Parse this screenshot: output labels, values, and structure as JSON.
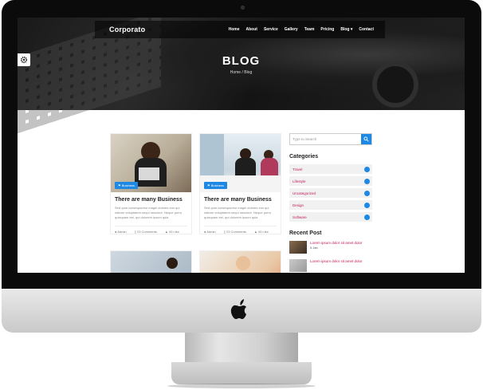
{
  "site": {
    "brand": "Corporato",
    "nav": [
      "Home",
      "About",
      "Service",
      "Gallery",
      "Team",
      "Pricing",
      "Blog",
      "Contact"
    ],
    "hero_title": "BLOG",
    "breadcrumb": "Home / Blog"
  },
  "posts": [
    {
      "tag": "Business",
      "title": "There are many Business",
      "excerpt": "Sed quia consequuntur magni dolores eos qui ratione voluptatem sequi nesciunt. Neque porro quisquam est, qui dolorem ipsum quia",
      "author": "Admin",
      "comments": "23 Comments",
      "likes": "09 Like"
    },
    {
      "tag": "Business",
      "title": "There are many Business",
      "excerpt": "Sed quia consequuntur magni dolores eos qui ratione voluptatem sequi nesciunt. Neque porro quisquam est, qui dolorem ipsum quia",
      "author": "Admin",
      "comments": "23 Comments",
      "likes": "09 Like"
    }
  ],
  "sidebar": {
    "search_placeholder": "Type to Search",
    "categories_title": "Categories",
    "categories": [
      "Travel",
      "Lifestyle",
      "Uncategorized",
      "Design",
      "Software"
    ],
    "recent_title": "Recent Post",
    "recent": [
      {
        "title": "Lorem ipsum dolor sit amet dolor",
        "date": "5 Jan"
      },
      {
        "title": "Lorem ipsum dolor sit amet dolor",
        "date": ""
      }
    ]
  },
  "colors": {
    "accent": "#1e88e5",
    "link": "#c2185b"
  }
}
